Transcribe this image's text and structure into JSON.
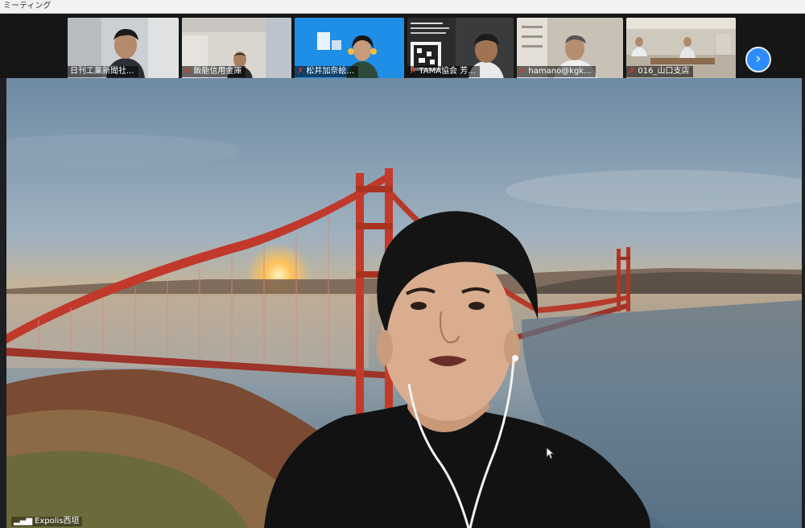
{
  "window": {
    "title": "ミーティング"
  },
  "participants": [
    {
      "name": "日刊工業新聞社..."
    },
    {
      "name": "飯能信用金庫"
    },
    {
      "name": "松井加奈絵..."
    },
    {
      "name": "TAMA協会 芳..."
    },
    {
      "name": "hamano@kgk..."
    },
    {
      "name": "016_山口支店"
    }
  ],
  "gallery": {
    "next_icon": "chevron-right-icon"
  },
  "speaker": {
    "name": "Expolis西垣"
  },
  "colors": {
    "accent": "#2d8cff",
    "muted_mic": "#e8321e"
  }
}
